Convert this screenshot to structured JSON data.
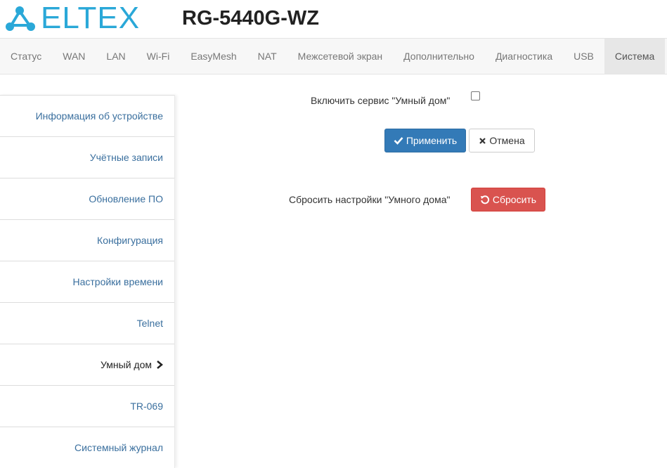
{
  "header": {
    "logo_text": "ELTEX",
    "model": "RG-5440G-WZ"
  },
  "topnav": {
    "tabs": [
      {
        "label": "Статус"
      },
      {
        "label": "WAN"
      },
      {
        "label": "LAN"
      },
      {
        "label": "Wi-Fi"
      },
      {
        "label": "EasyMesh"
      },
      {
        "label": "NAT"
      },
      {
        "label": "Межсетевой экран"
      },
      {
        "label": "Дополнительно"
      },
      {
        "label": "Диагностика"
      },
      {
        "label": "USB"
      },
      {
        "label": "Система"
      }
    ],
    "active": "Система"
  },
  "sidebar": {
    "items": [
      {
        "label": "Информация об устройстве"
      },
      {
        "label": "Учётные записи"
      },
      {
        "label": "Обновление ПО"
      },
      {
        "label": "Конфигурация"
      },
      {
        "label": "Настройки времени"
      },
      {
        "label": "Telnet"
      },
      {
        "label": "Умный дом"
      },
      {
        "label": "TR-069"
      },
      {
        "label": "Системный журнал"
      }
    ],
    "active": "Умный дом"
  },
  "main": {
    "enable_label": "Включить сервис \"Умный дом\"",
    "enable_checked": false,
    "apply_label": "Применить",
    "cancel_label": "Отмена",
    "reset_label_text": "Сбросить настройки \"Умного дома\"",
    "reset_button": "Сбросить"
  },
  "colors": {
    "brand": "#2aa8d8",
    "primary": "#337ab7",
    "danger": "#d9534f",
    "link": "#3a6f9e"
  }
}
